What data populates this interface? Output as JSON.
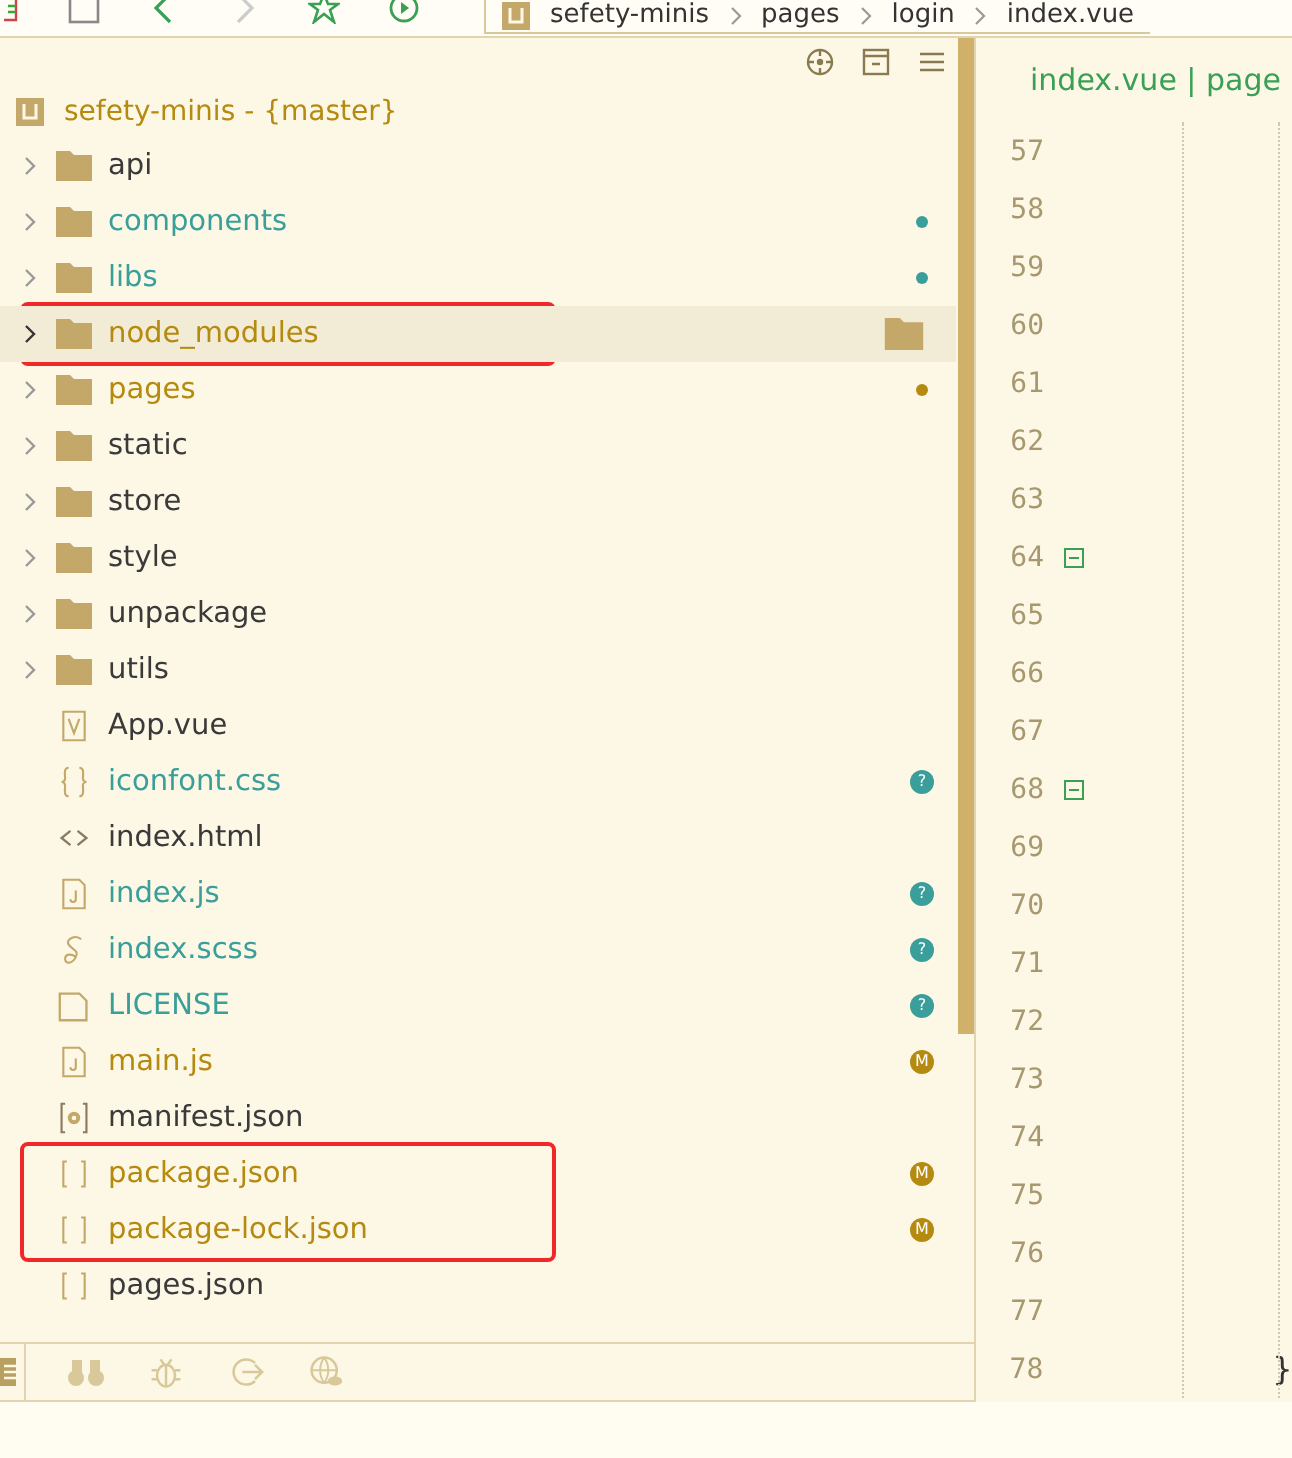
{
  "breadcrumb": [
    "sefety-minis",
    "pages",
    "login",
    "index.vue"
  ],
  "project": {
    "name": "sefety-minis - {master}"
  },
  "tree": [
    {
      "label": "api",
      "kind": "folder",
      "expanded": false,
      "color": "#3a3a3a",
      "selected": false,
      "outlined": false
    },
    {
      "label": "components",
      "kind": "folder",
      "expanded": false,
      "color": "#3a9f9a",
      "selected": false,
      "outlined": false,
      "badge": {
        "kind": "dot",
        "color": "#3a9f9a"
      }
    },
    {
      "label": "libs",
      "kind": "folder",
      "expanded": false,
      "color": "#3a9f9a",
      "selected": false,
      "outlined": false,
      "badge": {
        "kind": "dot",
        "color": "#3a9f9a"
      }
    },
    {
      "label": "node_modules",
      "kind": "folder",
      "expanded": false,
      "color": "#b58a10",
      "selected": true,
      "outlined": true
    },
    {
      "label": "pages",
      "kind": "folder",
      "expanded": false,
      "color": "#b58a10",
      "selected": false,
      "outlined": false,
      "badge": {
        "kind": "dot",
        "color": "#b58a10"
      }
    },
    {
      "label": "static",
      "kind": "folder",
      "expanded": false,
      "color": "#3a3a3a",
      "selected": false,
      "outlined": false
    },
    {
      "label": "store",
      "kind": "folder",
      "expanded": false,
      "color": "#3a3a3a",
      "selected": false,
      "outlined": false
    },
    {
      "label": "style",
      "kind": "folder",
      "expanded": false,
      "color": "#3a3a3a",
      "selected": false,
      "outlined": false
    },
    {
      "label": "unpackage",
      "kind": "folder",
      "expanded": false,
      "color": "#3a3a3a",
      "selected": false,
      "outlined": false
    },
    {
      "label": "utils",
      "kind": "folder",
      "expanded": false,
      "color": "#3a3a3a",
      "selected": false,
      "outlined": false
    },
    {
      "label": "App.vue",
      "kind": "vue",
      "color": "#3a3a3a",
      "selected": false,
      "outlined": false
    },
    {
      "label": "iconfont.css",
      "kind": "braces",
      "color": "#3a9f9a",
      "selected": false,
      "outlined": false,
      "badge": {
        "kind": "letter",
        "text": "?",
        "color": "#3a9f9a"
      }
    },
    {
      "label": "index.html",
      "kind": "code",
      "color": "#3a3a3a",
      "selected": false,
      "outlined": false
    },
    {
      "label": "index.js",
      "kind": "js",
      "color": "#3a9f9a",
      "selected": false,
      "outlined": false,
      "badge": {
        "kind": "letter",
        "text": "?",
        "color": "#3a9f9a"
      }
    },
    {
      "label": "index.scss",
      "kind": "sass",
      "color": "#3a9f9a",
      "selected": false,
      "outlined": false,
      "badge": {
        "kind": "letter",
        "text": "?",
        "color": "#3a9f9a"
      }
    },
    {
      "label": "LICENSE",
      "kind": "file",
      "color": "#3a9f9a",
      "selected": false,
      "outlined": false,
      "badge": {
        "kind": "letter",
        "text": "?",
        "color": "#3a9f9a"
      }
    },
    {
      "label": "main.js",
      "kind": "js",
      "color": "#b58a10",
      "selected": false,
      "outlined": false,
      "badge": {
        "kind": "letter",
        "text": "M",
        "color": "#b58a10"
      }
    },
    {
      "label": "manifest.json",
      "kind": "gear",
      "color": "#3a3a3a",
      "selected": false,
      "outlined": false
    },
    {
      "label": "package.json",
      "kind": "json",
      "color": "#b58a10",
      "selected": false,
      "outlined": true,
      "badge": {
        "kind": "letter",
        "text": "M",
        "color": "#b58a10"
      }
    },
    {
      "label": "package-lock.json",
      "kind": "json",
      "color": "#b58a10",
      "selected": false,
      "outlined": true,
      "badge": {
        "kind": "letter",
        "text": "M",
        "color": "#b58a10"
      }
    },
    {
      "label": "pages.json",
      "kind": "json",
      "color": "#3a3a3a",
      "selected": false,
      "outlined": false
    }
  ],
  "editor": {
    "tab": "index.vue | page",
    "lines": [
      {
        "number": "57"
      },
      {
        "number": "58"
      },
      {
        "number": "59"
      },
      {
        "number": "60"
      },
      {
        "number": "61"
      },
      {
        "number": "62"
      },
      {
        "number": "63"
      },
      {
        "number": "64",
        "fold": true
      },
      {
        "number": "65"
      },
      {
        "number": "66"
      },
      {
        "number": "67"
      },
      {
        "number": "68",
        "fold": true
      },
      {
        "number": "69"
      },
      {
        "number": "70"
      },
      {
        "number": "71"
      },
      {
        "number": "72"
      },
      {
        "number": "73"
      },
      {
        "number": "74"
      },
      {
        "number": "75"
      },
      {
        "number": "76"
      },
      {
        "number": "77"
      },
      {
        "number": "78",
        "code": "}"
      }
    ]
  }
}
